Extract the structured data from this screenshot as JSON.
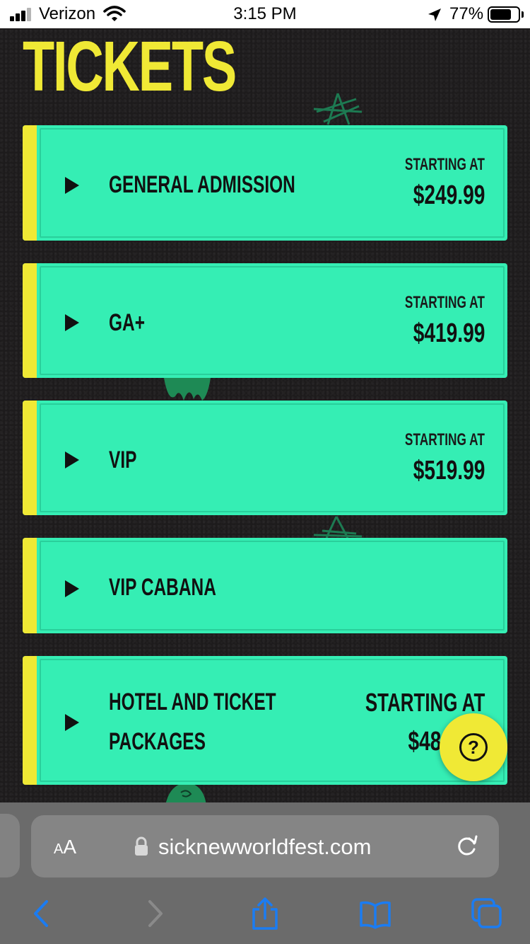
{
  "status_bar": {
    "carrier": "Verizon",
    "time": "3:15 PM",
    "battery_percent": "77%",
    "battery_level": 0.77
  },
  "page": {
    "title": "TICKETS"
  },
  "tickets": [
    {
      "name": "GENERAL ADMISSION",
      "starting_label": "STARTING AT",
      "price": "$249.99"
    },
    {
      "name": "GA+",
      "starting_label": "STARTING AT",
      "price": "$419.99"
    },
    {
      "name": "VIP",
      "starting_label": "STARTING AT",
      "price": "$519.99"
    },
    {
      "name": "VIP CABANA"
    },
    {
      "name_line1": "HOTEL AND TICKET",
      "name_line2": "PACKAGES",
      "starting_label": "STARTING AT",
      "price": "$48"
    }
  ],
  "help_button": {
    "symbol": "?"
  },
  "browser": {
    "aa_label_big": "A",
    "aa_label_small": "A",
    "url": "sicknewworldfest.com"
  },
  "colors": {
    "background": "#1d1b1c",
    "title_yellow": "#f0e935",
    "card_teal": "#35eeb4",
    "card_accent": "#f0e935",
    "text_dark": "#111111",
    "safari_blue": "#1b7cf2"
  },
  "icons": [
    "signal-icon",
    "wifi-icon",
    "location-arrow-icon",
    "battery-icon",
    "play-icon",
    "help-icon",
    "lock-icon",
    "reload-icon",
    "back-icon",
    "forward-icon",
    "share-icon",
    "bookmarks-icon",
    "tabs-icon"
  ]
}
